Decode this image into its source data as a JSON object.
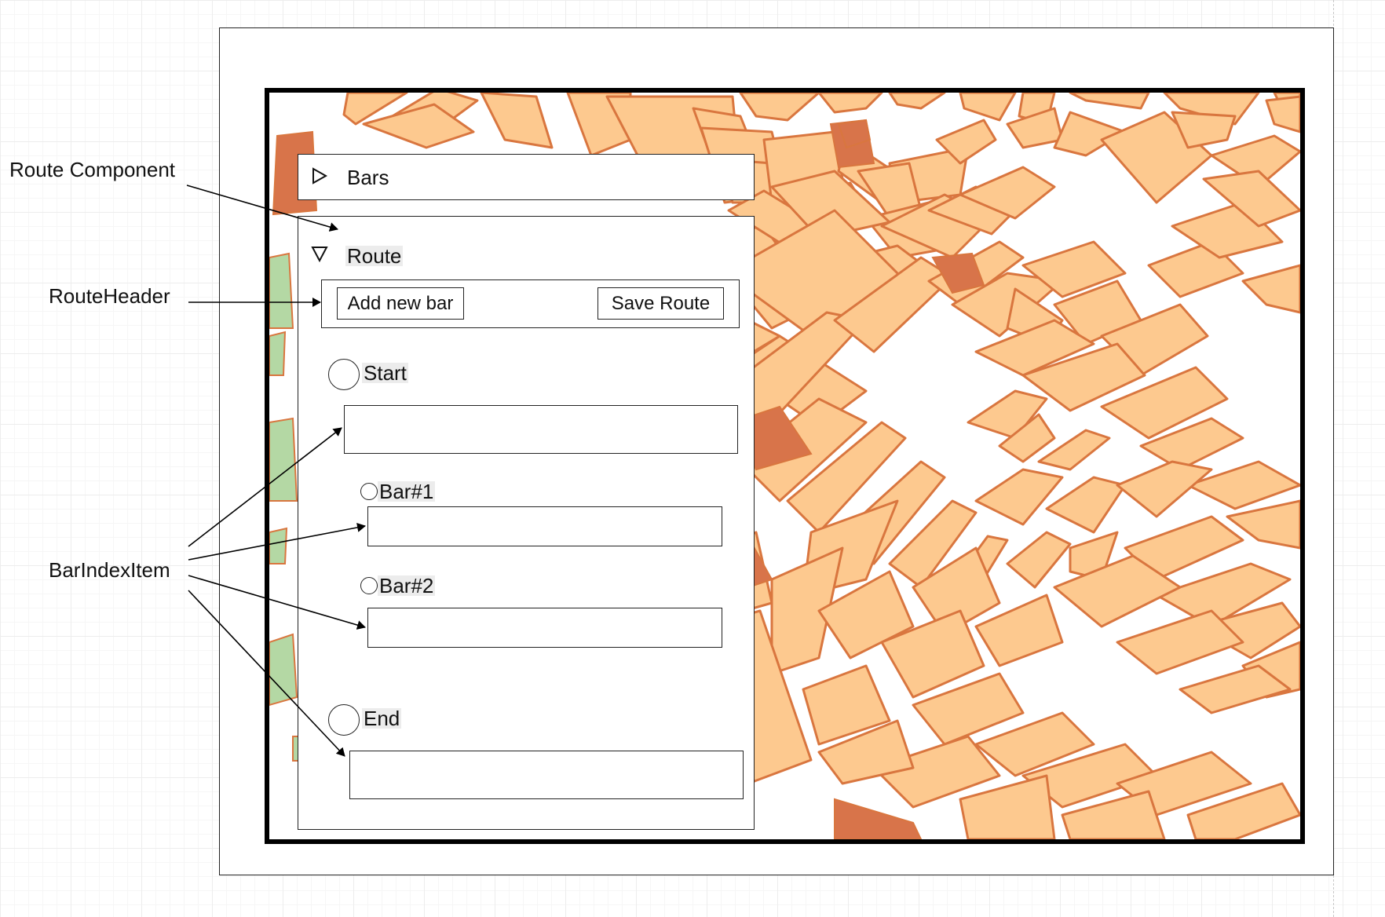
{
  "annotations": {
    "route_component": "Route Component",
    "route_header": "RouteHeader",
    "bar_index_item": "BarIndexItem"
  },
  "bars_panel": {
    "toggle_icon": "triangle-right-icon",
    "title": "Bars"
  },
  "route_panel": {
    "toggle_icon": "triangle-down-icon",
    "title": "Route",
    "header": {
      "add_button": "Add new bar",
      "save_button": "Save Route"
    },
    "stops": [
      {
        "label": "Start",
        "input_value": ""
      },
      {
        "label": "Bar#1",
        "input_value": ""
      },
      {
        "label": "Bar#2",
        "input_value": ""
      },
      {
        "label": "End",
        "input_value": ""
      }
    ]
  },
  "colors": {
    "block_fill": "#fdc98f",
    "block_stroke": "#d9763f",
    "dark_block": "#d8744a",
    "park_fill": "#b4d8a4"
  }
}
